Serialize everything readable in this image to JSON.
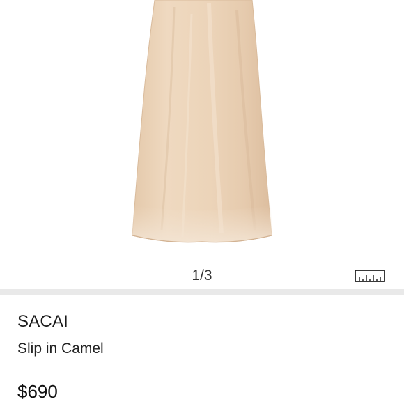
{
  "gallery": {
    "pager_text": "1/3",
    "image_subject": "camel slip dress",
    "size_guide_icon": "ruler-icon"
  },
  "product": {
    "brand": "SACAI",
    "title": "Slip in Camel",
    "price": "$690"
  },
  "colors": {
    "dress": "#ead2b8",
    "divider": "#e9e9e9"
  }
}
